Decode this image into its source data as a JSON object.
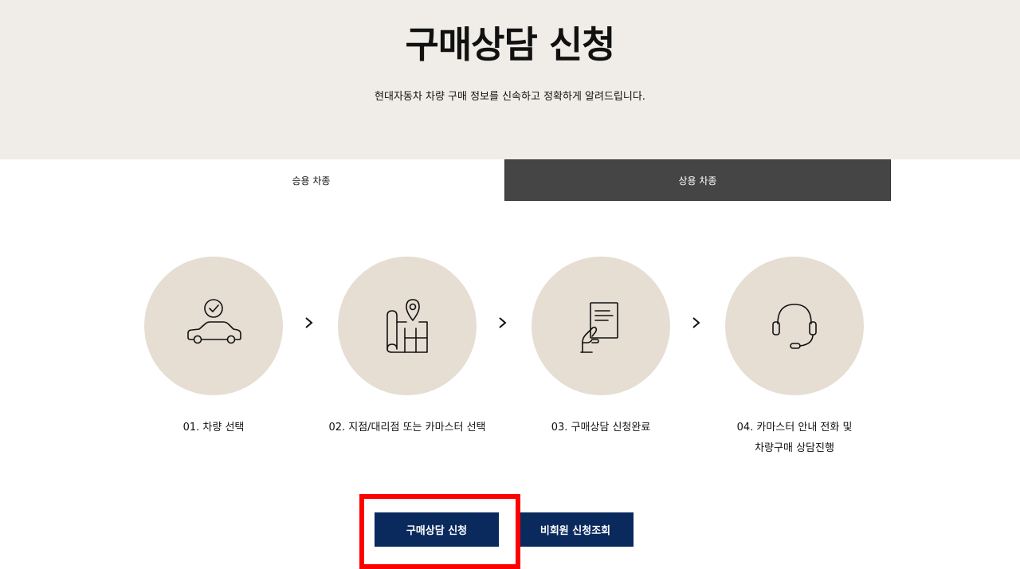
{
  "header": {
    "title": "구매상담 신청",
    "subtitle": "현대자동차 차량 구매 정보를 신속하고 정확하게 알려드립니다."
  },
  "tabs": [
    {
      "label": "승용 차종",
      "selected": false
    },
    {
      "label": "상용 차종",
      "selected": true
    }
  ],
  "steps": [
    {
      "label_lines": [
        "01. 차량 선택"
      ],
      "icon": "car-check-icon"
    },
    {
      "label_lines": [
        "02. 지점/대리점 또는 카마스터 선택"
      ],
      "icon": "map-pin-icon"
    },
    {
      "label_lines": [
        "03. 구매상담 신청완료"
      ],
      "icon": "document-hand-icon"
    },
    {
      "label_lines": [
        "04. 카마스터 안내 전화 및",
        "차량구매 상담진행"
      ],
      "icon": "headset-icon"
    }
  ],
  "actions": {
    "apply_label": "구매상담 신청",
    "lookup_label": "비회원 신청조회"
  },
  "colors": {
    "hero_bg": "#f0ece7",
    "circle_bg": "#e6ddd3",
    "active_tab_bg": "#454545",
    "button_bg": "#0a2a5e",
    "highlight": "#ff0000"
  }
}
